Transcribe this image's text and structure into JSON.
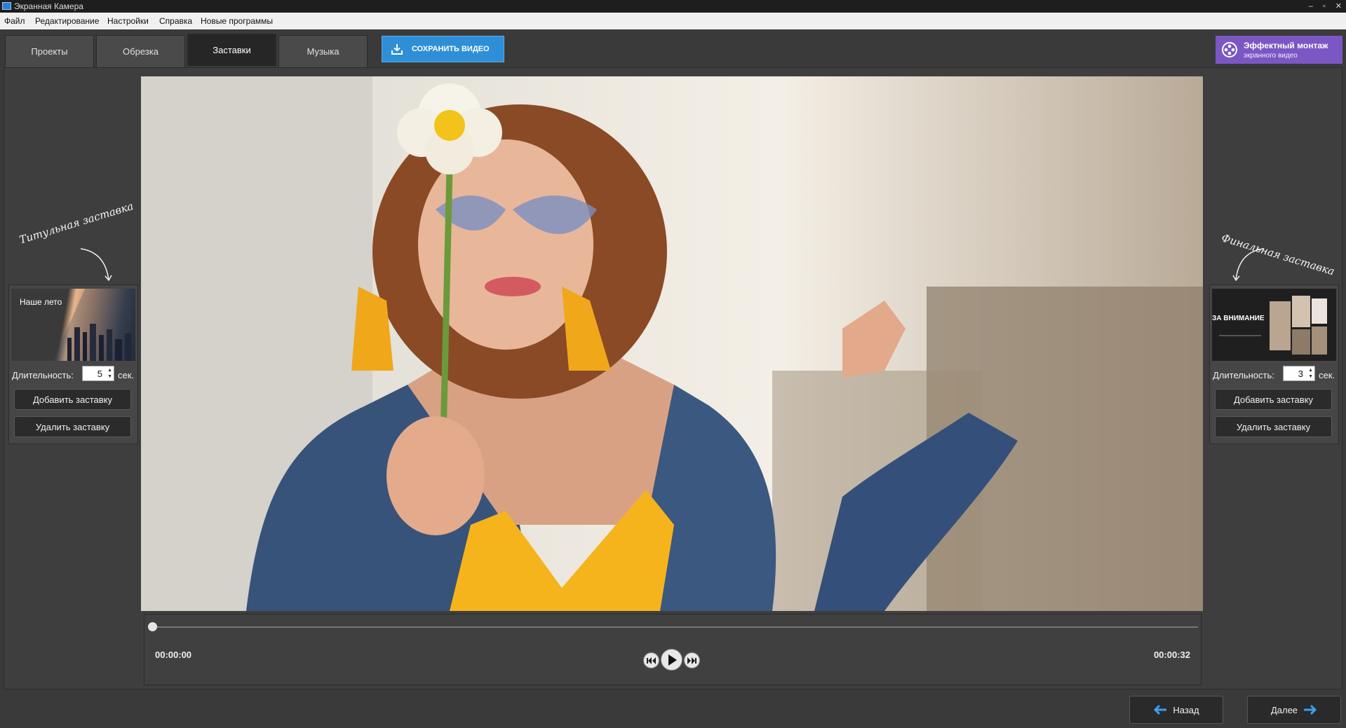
{
  "window": {
    "title": "Экранная Камера"
  },
  "menu": [
    "Файл",
    "Редактирование",
    "Настройки",
    "Справка",
    "Новые программы"
  ],
  "tabs": [
    {
      "label": "Проекты",
      "active": false
    },
    {
      "label": "Обрезка",
      "active": false
    },
    {
      "label": "Заставки",
      "active": true
    },
    {
      "label": "Музыка",
      "active": false
    }
  ],
  "save_button": {
    "label": "СОХРАНИТЬ ВИДЕО",
    "icon": "download-icon"
  },
  "promo": {
    "title": "Эффектный монтаж",
    "subtitle": "экранного видео",
    "icon": "film-reel-icon"
  },
  "left_panel": {
    "caption": "Титульная заставка",
    "thumb_text": "Наше лето",
    "duration_label": "Длительность:",
    "duration_value": "5",
    "unit": "сек.",
    "add_label": "Добавить заставку",
    "remove_label": "Удалить заставку"
  },
  "right_panel": {
    "caption": "Финальная заставка",
    "thumb_text": "ЗА ВНИМАНИЕ",
    "duration_label": "Длительность:",
    "duration_value": "3",
    "unit": "сек.",
    "add_label": "Добавить заставку",
    "remove_label": "Удалить заставку"
  },
  "player": {
    "current_time": "00:00:00",
    "total_time": "00:00:32",
    "progress": 0
  },
  "nav": {
    "back_label": "Назад",
    "next_label": "Далее"
  },
  "colors": {
    "accent_blue": "#2f8fd6",
    "promo_purple": "#7b57c4",
    "background": "#3a3a3a"
  }
}
